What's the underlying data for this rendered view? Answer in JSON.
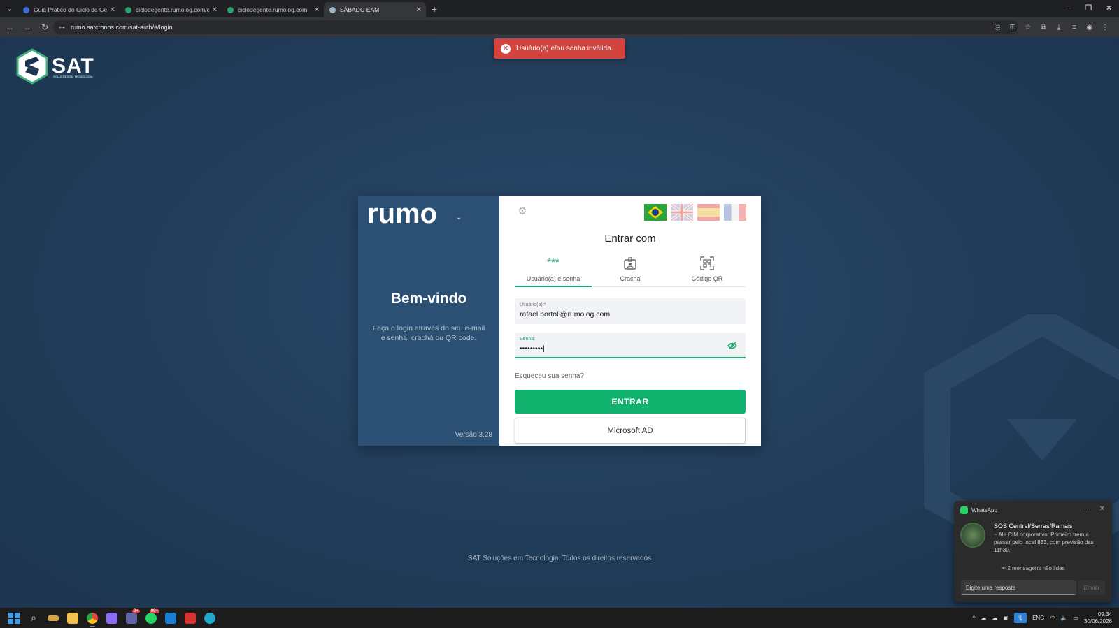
{
  "browser": {
    "tabs": [
      {
        "title": "Guia Prático do Ciclo de Gente",
        "favicon_color": "#3b6fd8",
        "active": false
      },
      {
        "title": "ciclodegente.rumolog.com/colab",
        "favicon_color": "#2aa56e",
        "active": false
      },
      {
        "title": "ciclodegente.rumolog.com",
        "favicon_color": "#2aa56e",
        "active": false
      },
      {
        "title": "SÁBADO EAM",
        "favicon_color": "#9fb8c4",
        "active": true
      }
    ],
    "url": "rumo.satcronos.com/sat-auth/#/login"
  },
  "brand": {
    "sat_name": "SAT",
    "sat_tagline": "SOLUÇÕES EM TECNOLOGIA",
    "rumo_name": "rumo"
  },
  "toast": {
    "message": "Usuário(a) e/ou senha inválida."
  },
  "login": {
    "welcome_title": "Bem-vindo",
    "welcome_subtitle": "Faça o login através do seu e-mail e senha, crachá ou QR code.",
    "version": "Versão 3.28",
    "title": "Entrar com",
    "methods": [
      {
        "label": "Usuário(a) e senha",
        "icon": "password-dots-icon",
        "active": true
      },
      {
        "label": "Crachá",
        "icon": "badge-icon",
        "active": false
      },
      {
        "label": "Código QR",
        "icon": "qr-code-icon",
        "active": false
      }
    ],
    "username_label": "Usuário(a):*",
    "username_value": "rafael.bortoli@rumolog.com",
    "password_label": "Senha:",
    "password_value": "•••••••••|",
    "forgot_link": "Esqueceu sua senha?",
    "submit_label": "ENTRAR",
    "alt_login_label": "Microsoft AD",
    "languages": [
      "pt-BR",
      "en-GB",
      "es-ES",
      "fr-FR"
    ]
  },
  "footer": {
    "text": "SAT Soluções em Tecnologia. Todos os direitos reservados"
  },
  "whatsapp": {
    "app": "WhatsApp",
    "group": "SOS Central/Serras/Ramais",
    "message": "~ Ale CIM corporativo: Primeiro trem a passar pelo local 833, com previsão das 11h30.",
    "unread": "2 mensagens não lidas",
    "reply_placeholder": "Digite uma resposta",
    "send_label": "Enviar"
  },
  "taskbar": {
    "apps": [
      {
        "name": "windows-start",
        "color": "#3aa0f0"
      },
      {
        "name": "search",
        "color": "#dddddd"
      },
      {
        "name": "widgets",
        "color": "#d9a441"
      },
      {
        "name": "file-explorer",
        "color": "#f2c14e"
      },
      {
        "name": "chrome",
        "color": "#e8453c"
      },
      {
        "name": "copilot",
        "color": "#8c6cf2"
      },
      {
        "name": "teams",
        "color": "#6264a7",
        "badge": "9+"
      },
      {
        "name": "whatsapp",
        "color": "#25d366",
        "badge": "99+"
      },
      {
        "name": "outlook",
        "color": "#1a7fd4"
      },
      {
        "name": "pdf-reader",
        "color": "#d8322c"
      },
      {
        "name": "edge",
        "color": "#1fa8c9"
      }
    ],
    "language": "ENG",
    "time": "09:34",
    "date": "30/06/2026"
  },
  "colors": {
    "accent": "#10b26d",
    "error": "#d4443e",
    "panel": "#2b5073"
  }
}
